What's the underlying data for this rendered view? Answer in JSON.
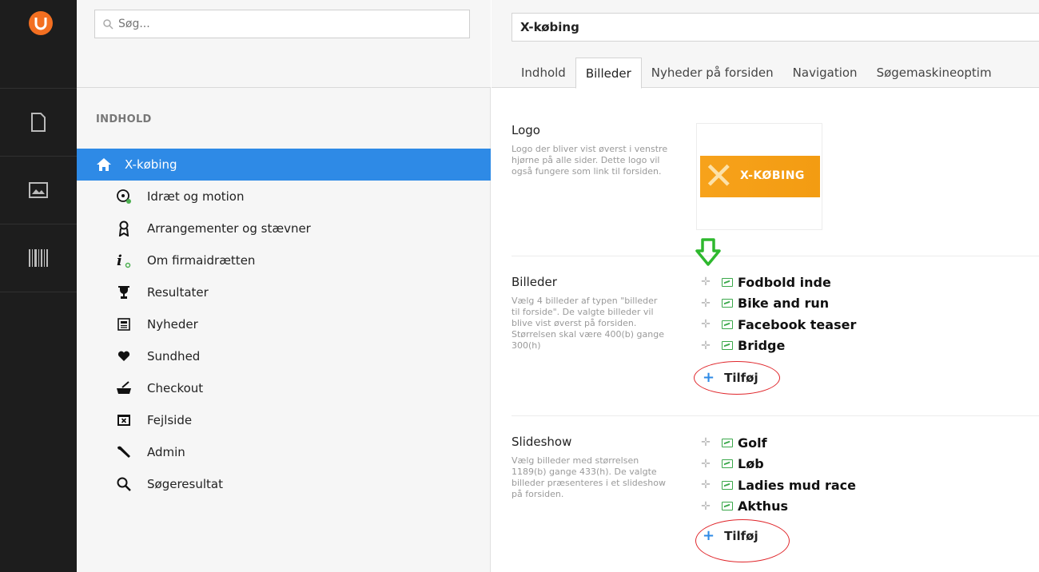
{
  "search": {
    "placeholder": "Søg..."
  },
  "tree": {
    "section_title": "INDHOLD",
    "root": {
      "label": "X-købing",
      "icon": "home-icon"
    },
    "items": [
      {
        "label": "Idræt og motion",
        "icon": "sports-icon"
      },
      {
        "label": "Arrangementer og stævner",
        "icon": "award-icon"
      },
      {
        "label": "Om firmaidrætten",
        "icon": "info-icon"
      },
      {
        "label": "Resultater",
        "icon": "trophy-icon"
      },
      {
        "label": "Nyheder",
        "icon": "newspaper-icon"
      },
      {
        "label": "Sundhed",
        "icon": "heart-icon"
      },
      {
        "label": "Checkout",
        "icon": "checkout-icon"
      },
      {
        "label": "Fejlside",
        "icon": "error-page-icon"
      },
      {
        "label": "Admin",
        "icon": "wrench-icon"
      },
      {
        "label": "Søgeresultat",
        "icon": "search-icon"
      }
    ]
  },
  "editor": {
    "name_value": "X-købing",
    "tabs": [
      {
        "label": "Indhold",
        "active": false
      },
      {
        "label": "Billeder",
        "active": true
      },
      {
        "label": "Nyheder på forsiden",
        "active": false
      },
      {
        "label": "Navigation",
        "active": false
      },
      {
        "label": "Søgemaskineoptim",
        "active": false
      }
    ],
    "logo": {
      "label": "Logo",
      "description": "Logo der bliver vist øverst i venstre hjørne på alle sider. Dette logo vil også fungere som link til forsiden.",
      "image_text": "X-KØBING"
    },
    "billeder": {
      "label": "Billeder",
      "description": "Vælg 4 billeder af typen \"billeder til forside\". De valgte billeder vil blive vist øverst på forsiden. Størrelsen skal være 400(b) gange 300(h)",
      "items": [
        "Fodbold inde",
        "Bike and run",
        "Facebook teaser",
        "Bridge"
      ],
      "add_label": "Tilføj"
    },
    "slideshow": {
      "label": "Slideshow",
      "description": "Vælg billeder med størrelsen 1189(b) gange 433(h). De valgte billeder præsenteres i et slideshow på forsiden.",
      "items": [
        "Golf",
        "Løb",
        "Ladies mud race",
        "Akthus"
      ],
      "add_label": "Tilføj"
    }
  },
  "colors": {
    "accent": "#2e8ae6",
    "brand": "#f36f21",
    "annotation_arrow": "#2eb82e",
    "annotation_circle": "#e0262b"
  }
}
